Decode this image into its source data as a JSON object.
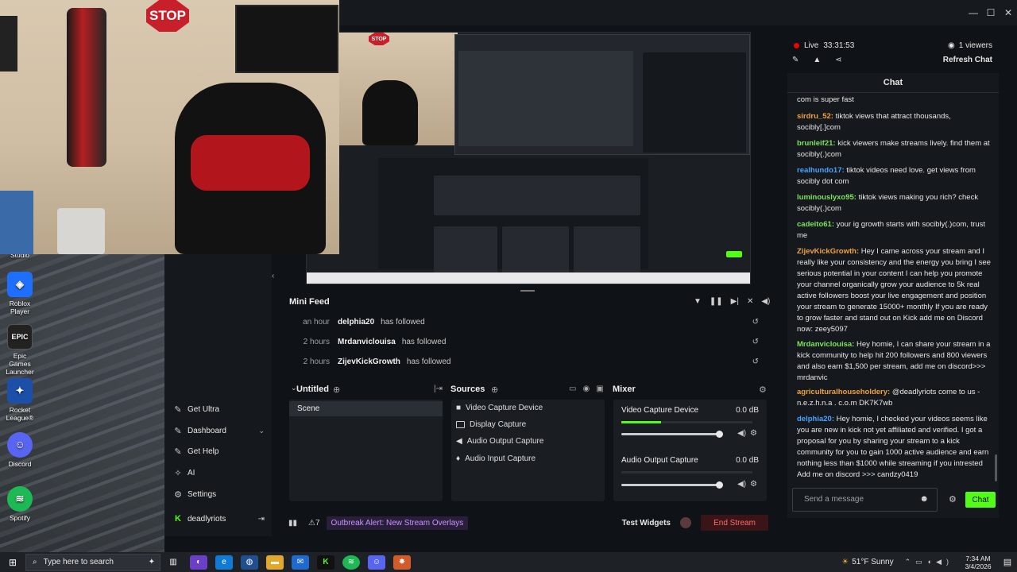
{
  "desktop": {
    "icons": [
      {
        "label": "Studio",
        "icon": "obs-studio-icon"
      },
      {
        "label": "Roblox Player",
        "icon": "roblox-icon"
      },
      {
        "label": "Epic Games Launcher",
        "icon": "epic-games-icon"
      },
      {
        "label": "Rocket League®",
        "icon": "rocket-league-icon"
      },
      {
        "label": "Discord",
        "icon": "discord-icon"
      },
      {
        "label": "Spotify",
        "icon": "spotify-icon"
      }
    ]
  },
  "webcam": {
    "sign_text": "STOP"
  },
  "stream": {
    "live_label": "Live",
    "duration": "33:31:53",
    "viewers": "1 viewers",
    "refresh_label": "Refresh Chat"
  },
  "nav": {
    "items": [
      {
        "label": "Get Ultra",
        "icon": "get-ultra-icon"
      },
      {
        "label": "Dashboard",
        "icon": "dashboard-icon"
      },
      {
        "label": "Get Help",
        "icon": "help-icon"
      },
      {
        "label": "AI",
        "icon": "ai-sparkle-icon"
      },
      {
        "label": "Settings",
        "icon": "gear-icon"
      }
    ],
    "user": "deadlyriots"
  },
  "minifeed": {
    "title": "Mini Feed",
    "events": [
      {
        "time": "an hour",
        "user": "delphia20",
        "action": "has followed"
      },
      {
        "time": "2 hours",
        "user": "Mrdanviclouisa",
        "action": "has followed"
      },
      {
        "time": "2 hours",
        "user": "ZijevKickGrowth",
        "action": "has followed"
      }
    ]
  },
  "scenes": {
    "title": "Untitled",
    "items": [
      "Scene"
    ]
  },
  "sources": {
    "title": "Sources",
    "items": [
      {
        "label": "Video Capture Device",
        "icon": "camera-icon"
      },
      {
        "label": "Display Capture",
        "icon": "monitor-icon"
      },
      {
        "label": "Audio Output Capture",
        "icon": "speaker-icon"
      },
      {
        "label": "Audio Input Capture",
        "icon": "microphone-icon"
      }
    ]
  },
  "mixer": {
    "title": "Mixer",
    "channels": [
      {
        "label": "Video Capture Device",
        "db": "0.0 dB",
        "level": 1.0
      },
      {
        "label": "Audio Output Capture",
        "db": "0.0 dB",
        "level": 1.0
      }
    ]
  },
  "bottom": {
    "alert": "Outbreak Alert: New Stream Overlays",
    "test_widgets": "Test Widgets",
    "end_stream": "End Stream"
  },
  "chat": {
    "title": "Chat",
    "input_placeholder": "Send a message",
    "send_label": "Chat",
    "messages": [
      {
        "user": "",
        "text": "com is super fast",
        "color": "#e8e8e8"
      },
      {
        "user": "sirdru_52:",
        "text": "tiktok views that attract thousands, socibly[.]com",
        "color": "#f0a23b"
      },
      {
        "user": "brunleif21:",
        "text": "kick viewers make streams lively. find them at socibly(.)com",
        "color": "#7ee35c"
      },
      {
        "user": "realhundo17:",
        "text": "tiktok videos need love. get views from socibly dot com",
        "color": "#4aa3ff"
      },
      {
        "user": "luminouslyxo95:",
        "text": "tiktok views making you rich? check socibly(.)com",
        "color": "#7ee35c"
      },
      {
        "user": "cadeito61:",
        "text": "your ig growth starts with socibly(.)com, trust me",
        "color": "#7ee35c"
      },
      {
        "user": "ZijevKickGrowth:",
        "text": "Hey I came across your stream and I really like your consistency and the energy you bring I see serious potential in your content I can help you promote your channel organically grow your audience to 5k real active followers boost your live engagement and position your stream to generate 15000+ monthly If you are ready to grow faster and stand out on Kick add me on Discord now: zeey5097",
        "color": "#f0a23b"
      },
      {
        "user": "Mrdanviclouisa:",
        "text": "Hey homie, I can share your stream in a kick community to help hit 200 followers and 800 viewers and also earn $1,500 per stream, add me on discord>>> mrdanvic",
        "color": "#7ee35c"
      },
      {
        "user": "agriculturalhouseholdery:",
        "text": "@deadlyriots come to us - n.e.z.h.n.a . c.o.m DK7K7wb",
        "color": "#f0a23b"
      },
      {
        "user": "delphia20:",
        "text": "Hey homie, I checked your videos seems like you are new in kick not yet affiliated and verified. I got a proposal for you by sharing your stream to a kick community for you to gain 1000 active audience and earn nothing less than $1000 while streaming if you intrested Add me on discord >>> candzy0419",
        "color": "#4aa3ff"
      }
    ]
  },
  "taskbar": {
    "search_placeholder": "Type here to search",
    "weather": "51°F  Sunny",
    "time": "7:34 AM",
    "date": "3/4/2026"
  },
  "colors": {
    "accent_green": "#53fc18",
    "live_red": "#eb0400",
    "end_stream_bg": "#3a1518"
  }
}
